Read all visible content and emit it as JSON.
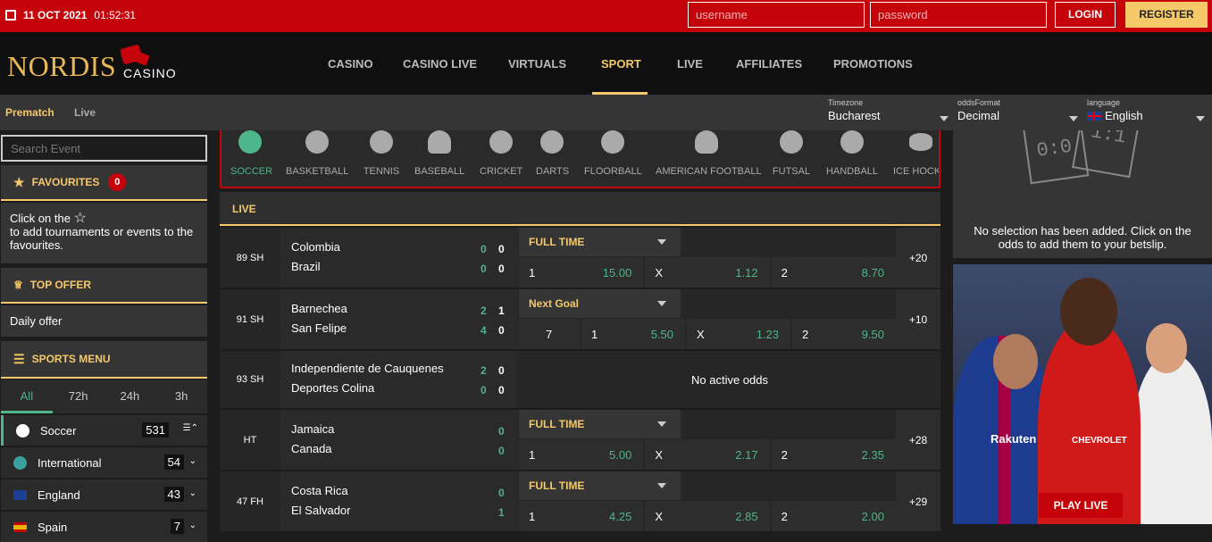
{
  "topbar": {
    "date": "11 OCT 2021",
    "time": "01:52:31",
    "username_placeholder": "username",
    "password_placeholder": "password",
    "login": "LOGIN",
    "register": "REGISTER"
  },
  "header": {
    "logo_main": "NORDIS",
    "logo_sub": "CASINO",
    "nav": [
      "CASINO",
      "CASINO LIVE",
      "VIRTUALS",
      "SPORT",
      "LIVE",
      "AFFILIATES",
      "PROMOTIONS"
    ],
    "active_nav": "SPORT"
  },
  "subbar": {
    "prematch": "Prematch",
    "live": "Live",
    "timezone": {
      "label": "Timezone",
      "value": "Bucharest"
    },
    "odds_format": {
      "label": "oddsFormat",
      "value": "Decimal"
    },
    "language": {
      "label": "language",
      "value": "English"
    }
  },
  "left": {
    "search_placeholder": "Search Event",
    "favourites": {
      "title": "FAVOURITES",
      "count": "0",
      "text1": "Click on the",
      "text2": "to add tournaments or events to the favourites."
    },
    "top_offer": {
      "title": "TOP OFFER",
      "text": "Daily offer"
    },
    "sports_menu": {
      "title": "SPORTS MENU"
    },
    "time_tabs": [
      "All",
      "72h",
      "24h",
      "3h"
    ],
    "sports": [
      {
        "name": "Soccer",
        "count": "531"
      },
      {
        "name": "International",
        "count": "54"
      },
      {
        "name": "England",
        "count": "43"
      },
      {
        "name": "Spain",
        "count": "7"
      }
    ]
  },
  "sports_strip": [
    "SOCCER",
    "BASKETBALL",
    "TENNIS",
    "BASEBALL",
    "CRICKET",
    "DARTS",
    "FLOORBALL",
    "AMERICAN FOOTBALL",
    "FUTSAL",
    "HANDBALL",
    "ICE HOCKEY"
  ],
  "live_header": "LIVE",
  "matches": [
    {
      "time": "89 SH",
      "home": "Colombia",
      "away": "Brazil",
      "h1": "0",
      "h2": "0",
      "a1": "0",
      "a2": "0",
      "market": "FULL TIME",
      "odds": [
        [
          "1",
          "15.00"
        ],
        [
          "X",
          "1.12"
        ],
        [
          "2",
          "8.70"
        ]
      ],
      "more": "+20"
    },
    {
      "time": "91 SH",
      "home": "Barnechea",
      "away": "San Felipe",
      "h1": "2",
      "h2": "1",
      "a1": "4",
      "a2": "0",
      "market": "Next Goal",
      "line": "7",
      "odds": [
        [
          "1",
          "5.50"
        ],
        [
          "X",
          "1.23"
        ],
        [
          "2",
          "9.50"
        ]
      ],
      "more": "+10"
    },
    {
      "time": "93 SH",
      "home": "Independiente de Cauquenes",
      "away": "Deportes Colina",
      "h1": "2",
      "h2": "0",
      "a1": "0",
      "a2": "0",
      "no_odds": "No active odds"
    },
    {
      "time": "HT",
      "home": "Jamaica",
      "away": "Canada",
      "h1": "0",
      "a1": "0",
      "market": "FULL TIME",
      "odds": [
        [
          "1",
          "5.00"
        ],
        [
          "X",
          "2.17"
        ],
        [
          "2",
          "2.35"
        ]
      ],
      "more": "+28"
    },
    {
      "time": "47 FH",
      "home": "Costa Rica",
      "away": "El Salvador",
      "h1": "0",
      "a1": "1",
      "market": "FULL TIME",
      "odds": [
        [
          "1",
          "4.25"
        ],
        [
          "X",
          "2.85"
        ],
        [
          "2",
          "2.00"
        ]
      ],
      "more": "+29"
    }
  ],
  "betslip": {
    "score1": "0:0",
    "score2": "1:1",
    "message": "No selection has been added. Click on the odds to add them to your betslip."
  },
  "promo": {
    "button": "PLAY LIVE",
    "sponsor": "Rakuten",
    "sponsor2": "CHEVROLET"
  },
  "colors": {
    "brand_red": "#c4040a",
    "gold": "#f5c96a",
    "green": "#4fb58a"
  }
}
